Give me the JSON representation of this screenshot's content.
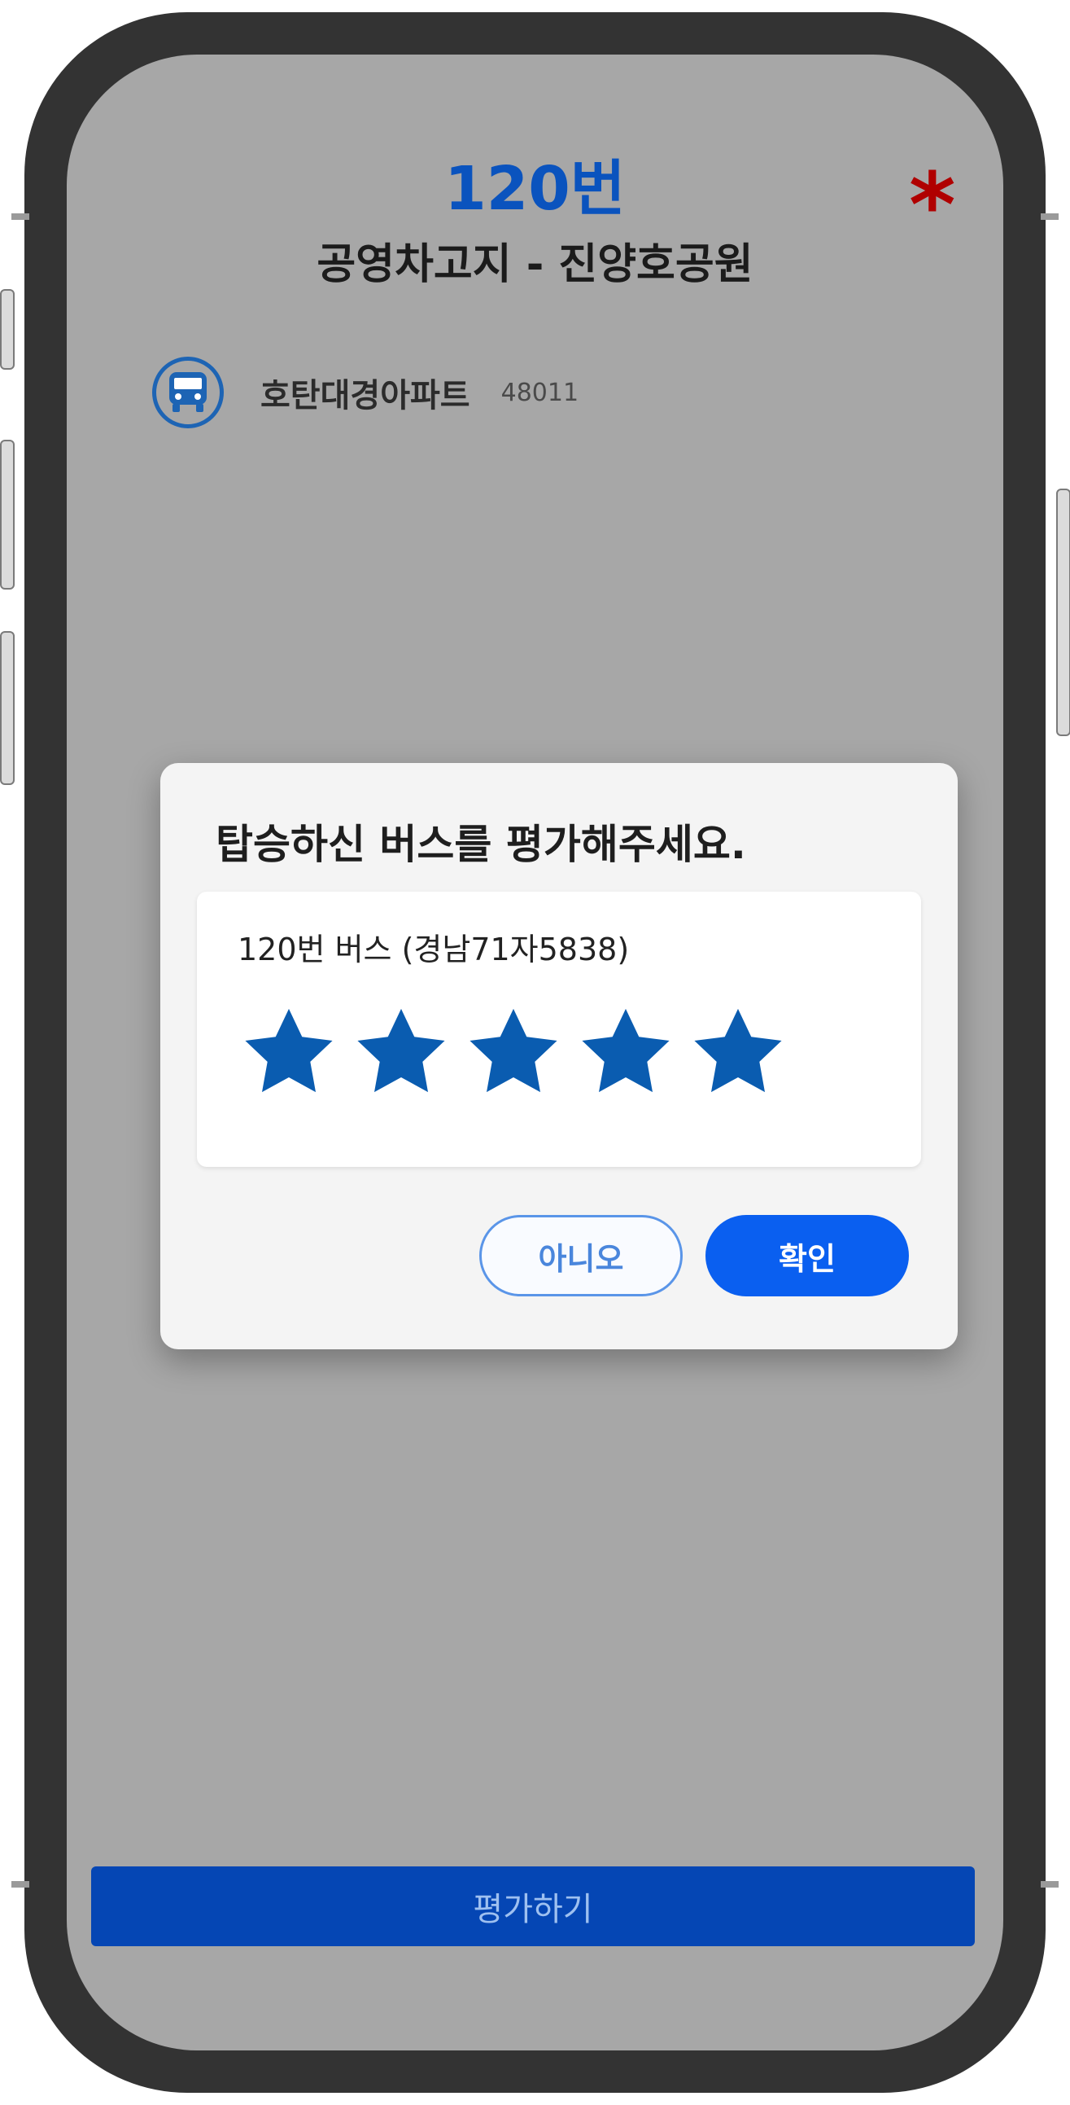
{
  "header": {
    "route_number": "120번",
    "route_name": "공영차고지 - 진양호공원",
    "asterisk": "*"
  },
  "stop": {
    "name": "호탄대경아파트",
    "id": "48011",
    "icon": "bus-icon"
  },
  "dialog": {
    "title": "탑승하신 버스를 평가해주세요.",
    "bus_info": "120번 버스 (경남71자5838)",
    "rating": 5,
    "rating_max": 5,
    "star_color": "#0a5cb0",
    "no_label": "아니오",
    "ok_label": "확인"
  },
  "footer": {
    "evaluate_label": "평가하기"
  },
  "colors": {
    "accent": "#0a53be",
    "primary_button": "#0a5ff0",
    "bottom_button": "#0546b4",
    "asterisk": "#b00000",
    "overlay": "#a7a7a7"
  }
}
